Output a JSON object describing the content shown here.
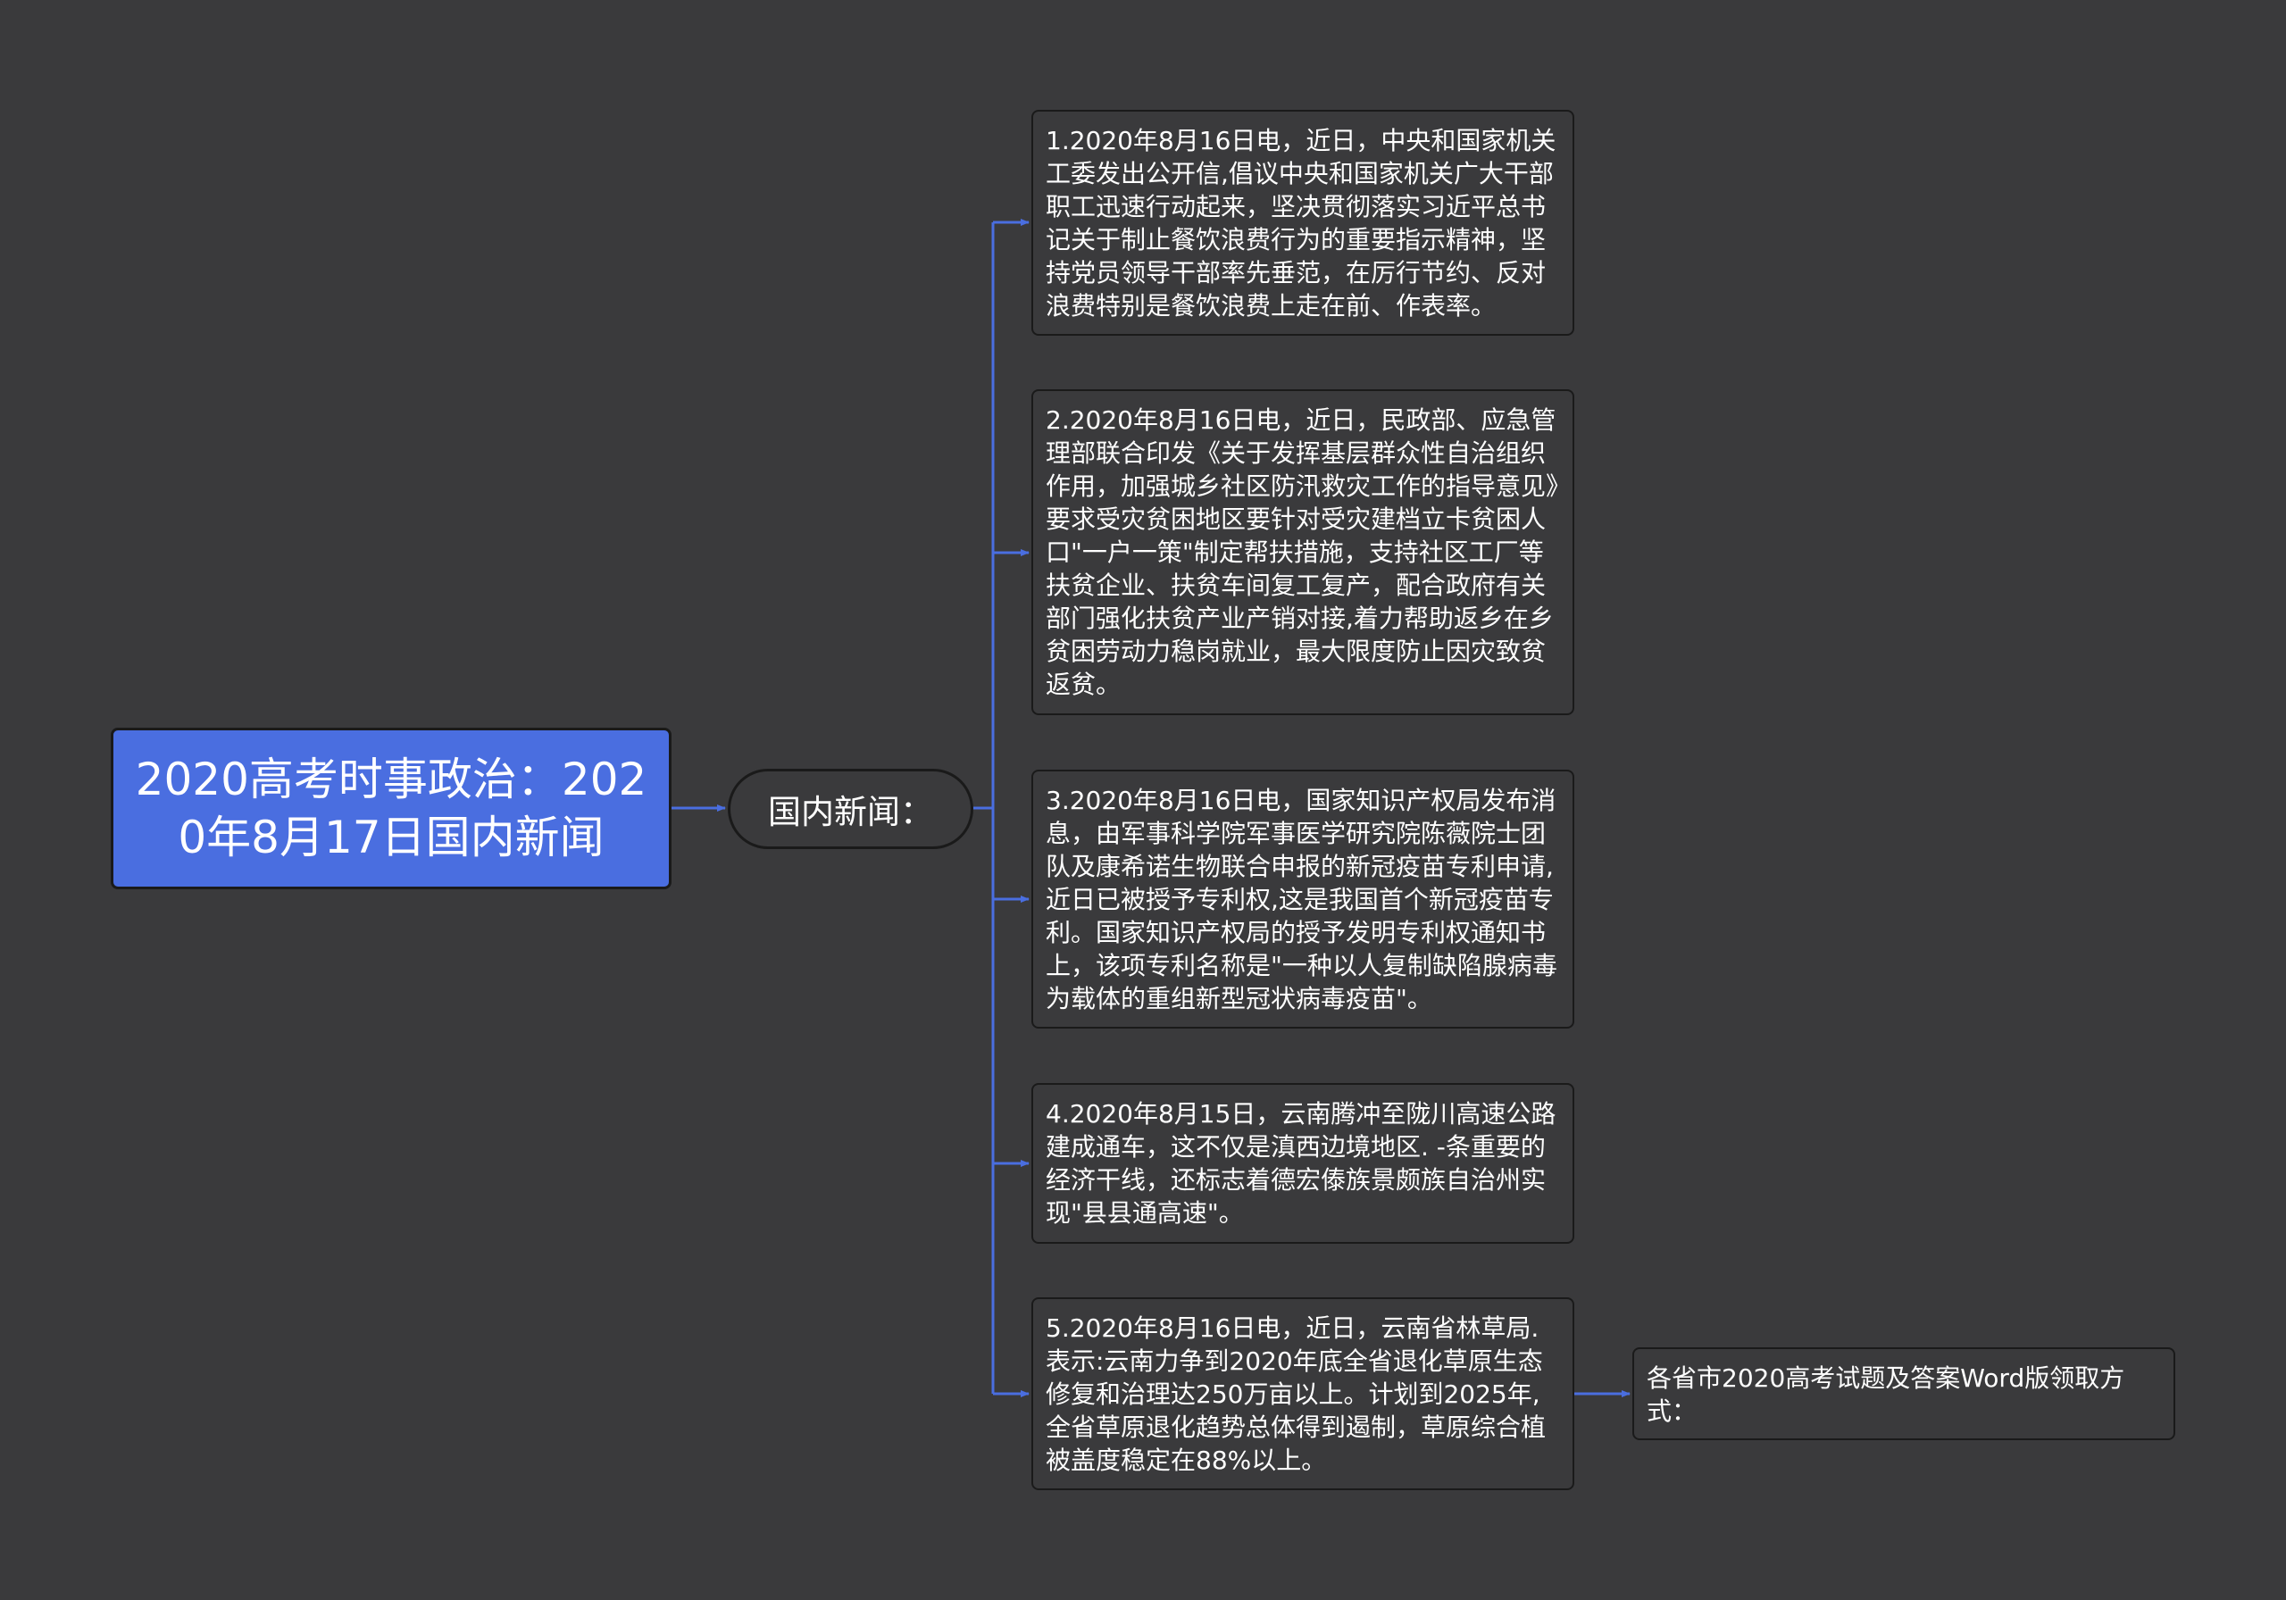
{
  "root": {
    "label": "2020高考时事政治：2020年8月17日国内新闻"
  },
  "branch": {
    "label": "国内新闻："
  },
  "leaves": [
    {
      "text": "1.2020年8月16日电，近日，中央和国家机关工委发出公开信,倡议中央和国家机关广大干部职工迅速行动起来，坚决贯彻落实习近平总书记关于制止餐饮浪费行为的重要指示精神，坚持党员领导干部率先垂范，在厉行节约、反对浪费特别是餐饮浪费上走在前、作表率。"
    },
    {
      "text": "2.2020年8月16日电，近日，民政部、应急管理部联合印发《关于发挥基层群众性自治组织作用，加强城乡社区防汛救灾工作的指导意见》要求受灾贫困地区要针对受灾建档立卡贫困人口\"一户一策\"制定帮扶措施，支持社区工厂等扶贫企业、扶贫车间复工复产，配合政府有关部门强化扶贫产业产销对接,着力帮助返乡在乡贫困劳动力稳岗就业，最大限度防止因灾致贫返贫。"
    },
    {
      "text": "3.2020年8月16日电，国家知识产权局发布消息，由军事科学院军事医学研究院陈薇院士团队及康希诺生物联合申报的新冠疫苗专利申请,近日已被授予专利权,这是我国首个新冠疫苗专利。国家知识产权局的授予发明专利权通知书上，该项专利名称是\"一种以人复制缺陷腺病毒为载体的重组新型冠状病毒疫苗\"。"
    },
    {
      "text": "4.2020年8月15日，云南腾冲至陇川高速公路建成通车，这不仅是滇西边境地区. -条重要的经济干线，还标志着德宏傣族景颇族自治州实现\"县县通高速\"。"
    },
    {
      "text": "5.2020年8月16日电，近日，云南省林草局.表示:云南力争到2020年底全省退化草原生态修复和治理达250万亩以上。计划到2025年,全省草原退化趋势总体得到遏制，草原综合植被盖度稳定在88%以上。"
    }
  ],
  "sub": {
    "text": "各省市2020高考试题及答案Word版领取方式："
  },
  "colors": {
    "background": "#3a3a3c",
    "root_fill": "#4a6ee0",
    "connector": "#4a6ee0",
    "border": "#1a1a1a",
    "text": "#ffffff"
  }
}
